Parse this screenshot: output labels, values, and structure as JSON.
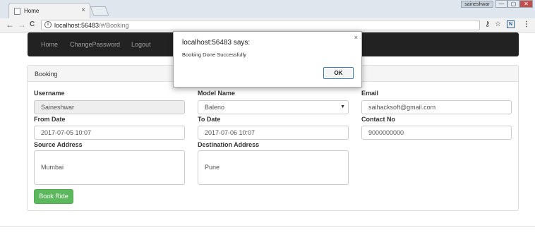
{
  "browser": {
    "tab_title": "Home",
    "tab_close": "×",
    "user_badge": "saineshwar",
    "window_minimize": "—",
    "window_maximize": "▢",
    "window_close": "✕",
    "back": "←",
    "forward": "→",
    "reload": "C",
    "info_icon": "i",
    "url_host": "localhost:56483",
    "url_path": "/#/Booking",
    "key_icon": "⚷",
    "star_icon": "☆",
    "extension_label": "N",
    "menu_icon": "⋮"
  },
  "navbar": {
    "items": [
      "Home",
      "ChangePassword",
      "Logout"
    ]
  },
  "panel": {
    "heading": "Booking"
  },
  "form": {
    "username_label": "Username",
    "username_value": "Saineshwar",
    "model_label": "Model Name",
    "model_value": "Baleno",
    "email_label": "Email",
    "email_value": "saihacksoft@gmail.com",
    "from_label": "From Date",
    "from_value": "2017-07-05 10:07",
    "to_label": "To Date",
    "to_value": "2017-07-06 10:07",
    "contact_label": "Contact No",
    "contact_value": "9000000000",
    "source_label": "Source Address",
    "source_value": "Mumbai",
    "destination_label": "Destination Address",
    "destination_value": "Pune",
    "submit_label": "Book Ride"
  },
  "dialog": {
    "title": "localhost:56483 says:",
    "message": "Booking Done Successfully",
    "ok_label": "OK",
    "close": "×"
  },
  "colors": {
    "navbar_bg": "#222222",
    "button_success": "#5cb85c",
    "panel_heading_bg": "#f5f5f5"
  }
}
